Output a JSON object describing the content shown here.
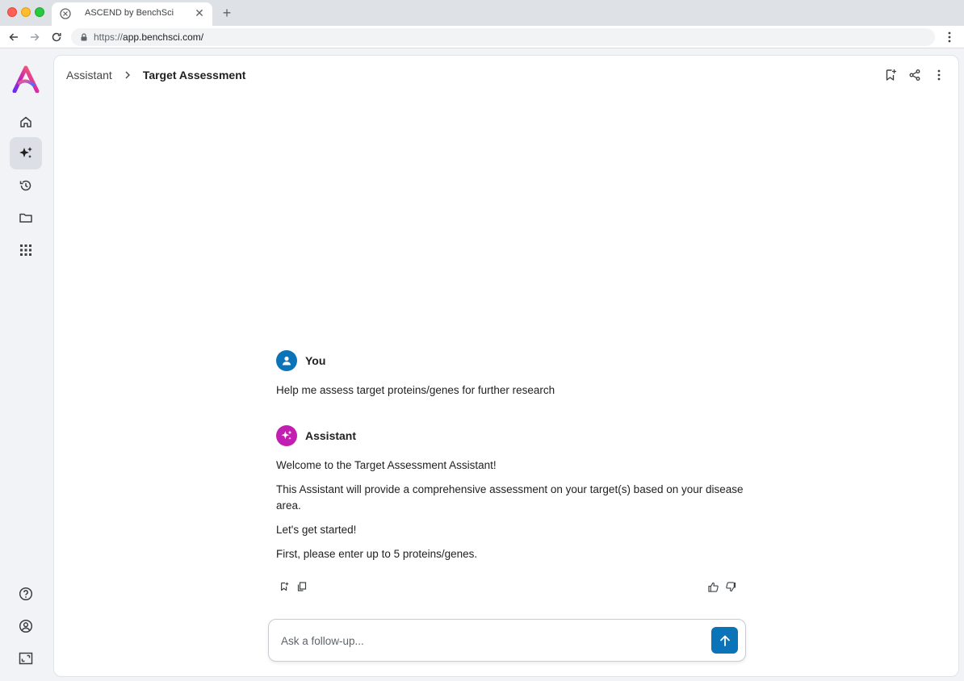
{
  "browser": {
    "tab_title": "ASCEND by BenchSci",
    "url_scheme": "https://",
    "url_host": "app.benchsci.com/"
  },
  "sidebar": {
    "items": [
      {
        "name": "home",
        "icon": "home-icon"
      },
      {
        "name": "assistant",
        "icon": "sparkles-icon",
        "active": true
      },
      {
        "name": "history",
        "icon": "history-icon"
      },
      {
        "name": "folders",
        "icon": "folder-icon"
      },
      {
        "name": "apps",
        "icon": "grid-icon"
      }
    ],
    "bottom_items": [
      {
        "name": "help",
        "icon": "help-icon"
      },
      {
        "name": "account",
        "icon": "account-icon"
      },
      {
        "name": "fullscreen",
        "icon": "fullscreen-icon"
      }
    ]
  },
  "header": {
    "breadcrumb_root": "Assistant",
    "breadcrumb_current": "Target Assessment"
  },
  "conversation": {
    "user_name": "You",
    "user_message": "Help me assess target proteins/genes for further research",
    "assistant_name": "Assistant",
    "assistant_paragraphs": [
      "Welcome to the Target Assessment Assistant!",
      "This Assistant will provide a comprehensive assessment on your target(s) based on your disease area.",
      "Let's get started!",
      "First, please enter up to 5 proteins/genes."
    ]
  },
  "composer": {
    "placeholder": "Ask a follow-up..."
  },
  "colors": {
    "accent": "#0b73b8",
    "assistant_avatar": "#c21fb0",
    "active_nav": "#dcdfe6"
  }
}
